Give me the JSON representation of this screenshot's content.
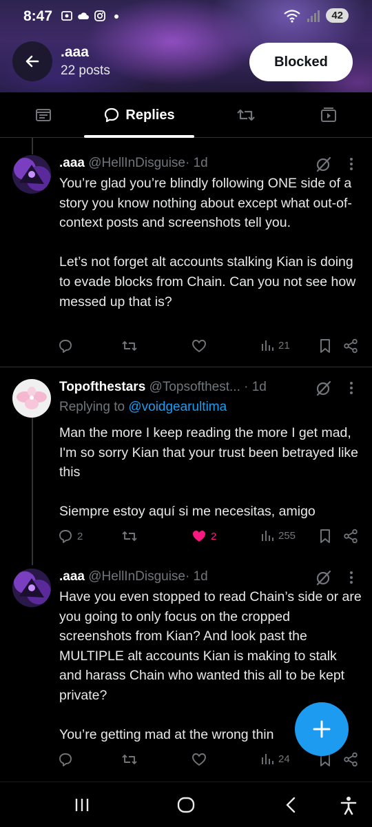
{
  "status_bar": {
    "time": "8:47",
    "battery": "42",
    "left_icons": [
      "screenshot-icon",
      "cloud-icon",
      "instagram-icon",
      "dot-icon"
    ],
    "right_icons": [
      "wifi-icon",
      "signal-icon",
      "battery-icon"
    ]
  },
  "profile": {
    "name": ".aaa",
    "posts": "22 posts",
    "blocked_label": "Blocked"
  },
  "tabs": [
    {
      "icon": "post-icon",
      "label": "",
      "active": false
    },
    {
      "icon": "speech-bubble-icon",
      "label": "Replies",
      "active": true
    },
    {
      "icon": "repost-icon",
      "label": "",
      "active": false
    },
    {
      "icon": "media-icon",
      "label": "",
      "active": false
    }
  ],
  "posts": [
    {
      "name": ".aaa",
      "handle": "@HellInDisguise",
      "time": "· 1d",
      "reply_to": "",
      "body_paragraphs": [
        "You’re glad you’re blindly following ONE side of a story you know nothing about except what out-of-context posts and screenshots tell you.",
        "Let’s not forget alt accounts stalking Kian is doing to evade blocks from Chain. Can you not see how messed up that is?"
      ],
      "reply_count": "",
      "repost_count": "",
      "like_count": "",
      "liked": false,
      "views": "21"
    },
    {
      "name": "Topofthestars",
      "handle": "@Topsofthest...",
      "time": "· 1d",
      "reply_to_prefix": "Replying to ",
      "reply_to": "@voidgearultima",
      "body_paragraphs": [
        "Man the more I keep reading the more I get mad, I'm so sorry Kian that your trust been betrayed like this",
        "Siempre estoy aquí si me necesitas, amigo"
      ],
      "reply_count": "2",
      "repost_count": "",
      "like_count": "2",
      "liked": true,
      "views": "255"
    },
    {
      "name": ".aaa",
      "handle": "@HellInDisguise",
      "time": "· 1d",
      "reply_to": "",
      "body_paragraphs": [
        "Have you even stopped to read Chain’s side or are you going to only focus on the cropped screenshots from Kian? And look past the MULTIPLE alt accounts Kian is making to stalk and harass Chain who wanted this all to be kept private?",
        "You’re getting mad at the wrong thin"
      ],
      "reply_count": "",
      "repost_count": "",
      "like_count": "",
      "liked": false,
      "views": "24"
    }
  ],
  "colors": {
    "accent": "#1d9bf0",
    "like": "#f91880",
    "secondary_text": "#71767b",
    "divider": "#2f3336"
  },
  "fab": {
    "icon": "plus-icon"
  },
  "nav_bar": {
    "items": [
      "recents-icon",
      "home-icon",
      "back-icon",
      "accessibility-icon"
    ]
  }
}
